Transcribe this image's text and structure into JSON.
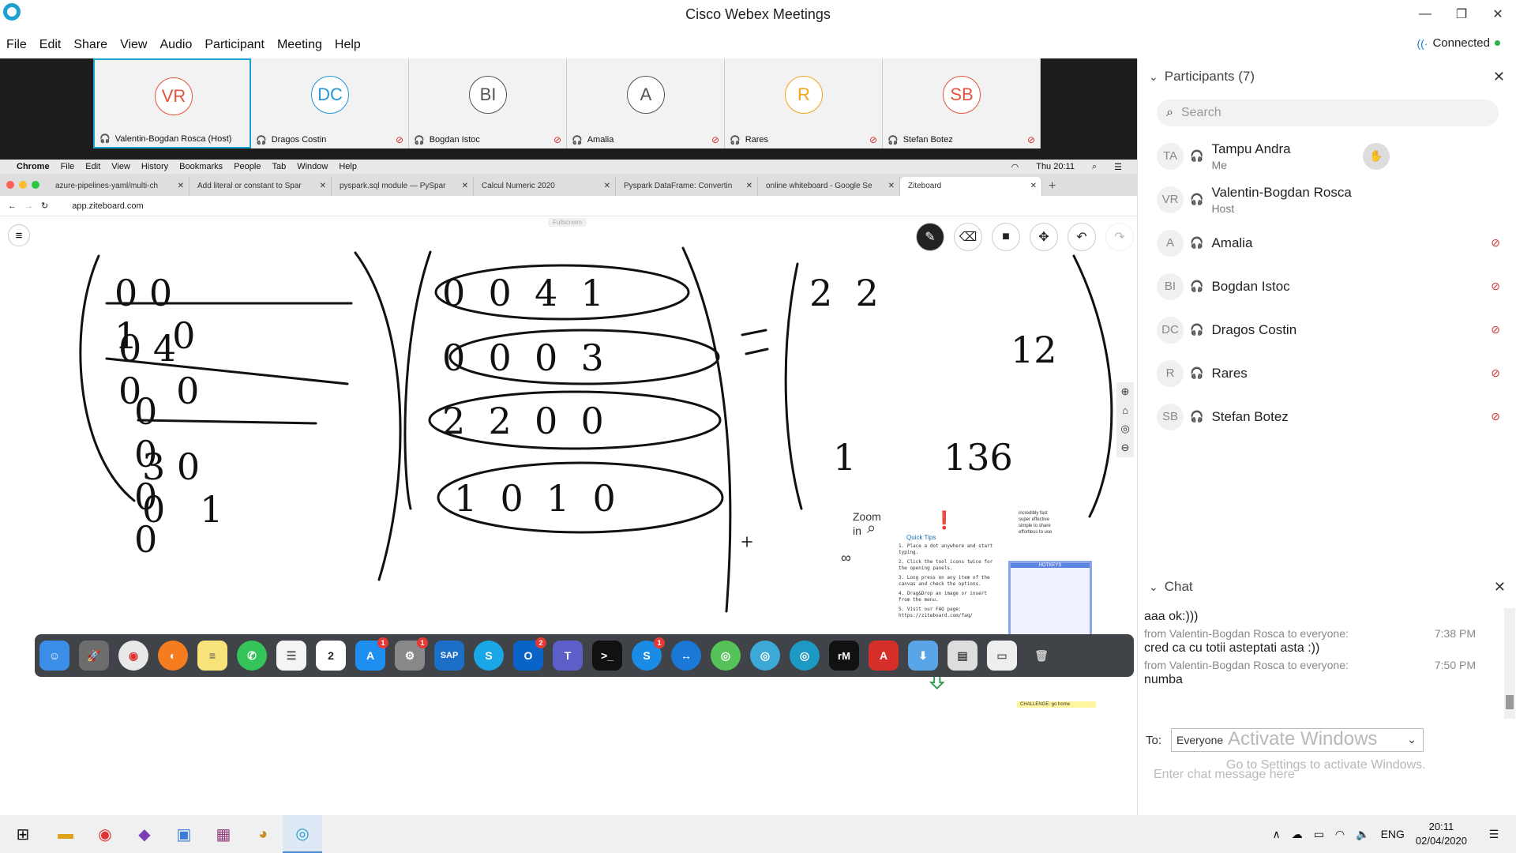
{
  "window": {
    "title": "Cisco Webex Meetings",
    "status": "Connected"
  },
  "menu": [
    "File",
    "Edit",
    "Share",
    "View",
    "Audio",
    "Participant",
    "Meeting",
    "Help"
  ],
  "thumbnails": [
    {
      "initials": "VR",
      "name": "Valentin-Bogdan Rosca (Host)",
      "color": "#e5533d",
      "muted": false
    },
    {
      "initials": "DC",
      "name": "Dragos Costin",
      "color": "#2197d6",
      "muted": true
    },
    {
      "initials": "BI",
      "name": "Bogdan Istoc",
      "color": "#555555",
      "muted": true
    },
    {
      "initials": "A",
      "name": "Amalia",
      "color": "#555555",
      "muted": true
    },
    {
      "initials": "R",
      "name": "Rares",
      "color": "#f2a21b",
      "muted": true
    },
    {
      "initials": "SB",
      "name": "Stefan Botez",
      "color": "#e5533d",
      "muted": true
    }
  ],
  "mac": {
    "menus": [
      "Chrome",
      "File",
      "Edit",
      "View",
      "History",
      "Bookmarks",
      "People",
      "Tab",
      "Window",
      "Help"
    ],
    "clock": "Thu 20:11",
    "tabs": [
      "azure-pipelines-yaml/multi-ch",
      "Add literal or constant to Spar",
      "pyspark.sql module — PySpar",
      "Calcul Numeric 2020",
      "Pyspark DataFrame: Convertin",
      "online whiteboard - Google Se",
      "Ziteboard"
    ],
    "url": "app.ziteboard.com",
    "fullscreen": "Fullscreen"
  },
  "tutorial": {
    "zoom": "Zoom",
    "zoom_in": "in",
    "quick_tips": "Quick Tips",
    "tips": [
      "1. Place a dot anywhere and start typing.",
      "2. Click the tool icons twice for the opening panels.",
      "3. Long press on any item of the canvas and check the options.",
      "4. Drag&Drop an image or insert from the menu.",
      "5. Visit our FAQ page: https://ziteboard.com/faq/"
    ],
    "features": [
      "incredibly fast",
      "super effective",
      "simple to share",
      "effortless to use"
    ],
    "hotkeys": "HOTKEYS",
    "challenge": "CHALLENGE: go home"
  },
  "participants": {
    "header": "Participants (7)",
    "search_placeholder": "Search",
    "list": [
      {
        "initials": "TA",
        "name": "Tampu Andra",
        "role": "Me",
        "muted": false,
        "raise": true
      },
      {
        "initials": "VR",
        "name": "Valentin-Bogdan Rosca",
        "role": "Host",
        "muted": false,
        "raise": false
      },
      {
        "initials": "A",
        "name": "Amalia",
        "role": "",
        "muted": true,
        "raise": false
      },
      {
        "initials": "BI",
        "name": "Bogdan Istoc",
        "role": "",
        "muted": true,
        "raise": false
      },
      {
        "initials": "DC",
        "name": "Dragos Costin",
        "role": "",
        "muted": true,
        "raise": false
      },
      {
        "initials": "R",
        "name": "Rares",
        "role": "",
        "muted": true,
        "raise": false
      },
      {
        "initials": "SB",
        "name": "Stefan Botez",
        "role": "",
        "muted": true,
        "raise": false
      }
    ]
  },
  "chat": {
    "header": "Chat",
    "messages": [
      {
        "from": "",
        "time": "",
        "text": "aaa ok:)))"
      },
      {
        "from": "from Valentin-Bogdan Rosca to everyone:",
        "time": "7:38 PM",
        "text": "cred ca cu totii asteptati asta :))"
      },
      {
        "from": "from Valentin-Bogdan Rosca to everyone:",
        "time": "7:50 PM",
        "text": "numba"
      }
    ],
    "to_label": "To:",
    "to_value": "Everyone",
    "placeholder": "Enter chat message here"
  },
  "watermark": {
    "line1": "Activate Windows",
    "line2": "Go to Settings to activate Windows."
  },
  "taskbar": {
    "lang": "ENG",
    "time": "20:11",
    "date": "02/04/2020"
  }
}
